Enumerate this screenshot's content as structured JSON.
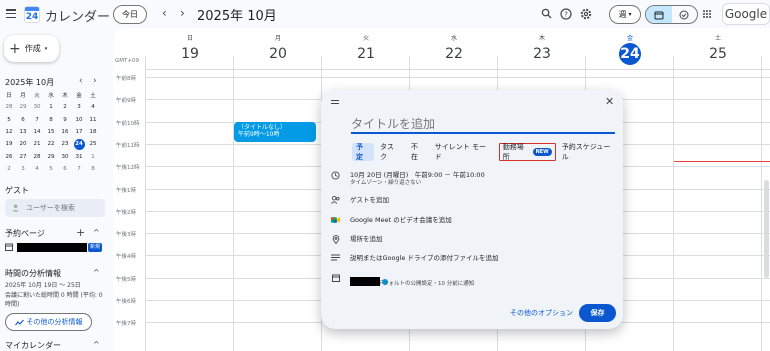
{
  "header": {
    "app_title": "カレンダー",
    "logo_day": "24",
    "today_label": "今日",
    "prev": "‹",
    "next": "›",
    "month_title": "2025年 10月",
    "view_label": "週",
    "view_chevron": "▾",
    "account_label": "Google"
  },
  "sidebar": {
    "create_label": "作成",
    "create_plus": "+",
    "create_chevron": "▾",
    "mini_title": "2025年 10月",
    "mini_prev": "‹",
    "mini_next": "›",
    "weekdays": [
      "日",
      "月",
      "火",
      "水",
      "木",
      "金",
      "土"
    ],
    "weeks": [
      [
        "28",
        "29",
        "30",
        "1",
        "2",
        "3",
        "4"
      ],
      [
        "5",
        "6",
        "7",
        "8",
        "9",
        "10",
        "11"
      ],
      [
        "12",
        "13",
        "14",
        "15",
        "16",
        "17",
        "18"
      ],
      [
        "19",
        "20",
        "21",
        "22",
        "23",
        "24",
        "25"
      ],
      [
        "26",
        "27",
        "28",
        "29",
        "30",
        "31",
        "1"
      ],
      [
        "2",
        "3",
        "4",
        "5",
        "6",
        "7",
        "8"
      ]
    ],
    "guest_heading": "ゲスト",
    "guest_placeholder": "ユーザーを検索",
    "booking_heading": "予約ページ",
    "booking_plus": "+",
    "booking_chevron": "^",
    "booking_badge": "新規",
    "analysis_heading": "時間の分析情報",
    "analysis_chevron": "^",
    "analysis_range": "2025年 10月 19日 ～ 25日",
    "analysis_meetings": "会議に割いた総時間 0 時間 (平均: 0 時間)",
    "analysis_button": "その他の分析情報",
    "my_calendars": "マイカレンダー",
    "my_calendars_chevron": "^"
  },
  "calendar": {
    "timezone": "GMT+09",
    "days": [
      {
        "dow": "日",
        "num": "19"
      },
      {
        "dow": "月",
        "num": "20"
      },
      {
        "dow": "火",
        "num": "21"
      },
      {
        "dow": "水",
        "num": "22"
      },
      {
        "dow": "木",
        "num": "23"
      },
      {
        "dow": "金",
        "num": "24",
        "today": true
      },
      {
        "dow": "土",
        "num": "25"
      }
    ],
    "hours": [
      "午前8時",
      "午前9時",
      "午前10時",
      "午前11時",
      "午後12時",
      "午後1時",
      "午後2時",
      "午後3時",
      "午後4時",
      "午後5時",
      "午後6時",
      "午後7時"
    ],
    "event": {
      "title": "（タイトルなし）",
      "time": "午前9時～10時"
    }
  },
  "dialog": {
    "title_placeholder": "タイトルを追加",
    "close": "✕",
    "tabs": [
      "予定",
      "タスク",
      "不在",
      "サイレント モード",
      "勤務場所",
      "予約スケジュール"
    ],
    "new_badge": "NEW",
    "date_time": "10月 20日 (月曜日)　午前9:00 － 午前10:00",
    "timezone_note": "タイムゾーン・繰り返さない",
    "add_guests": "ゲストを追加",
    "meet": "Google Meet のビデオ会議を追加",
    "add_location": "場所を追加",
    "add_description": "説明またはGoogle ドライブの添付ファイルを追加",
    "calendar_note": "予定あり・デフォルトの公開設定・10 分前に通知",
    "more_options": "その他のオプション",
    "save": "保存"
  },
  "colors": {
    "accent": "#0b57d0",
    "event": "#039be5",
    "now_line": "#ea4335",
    "highlight_border": "#d93025"
  }
}
